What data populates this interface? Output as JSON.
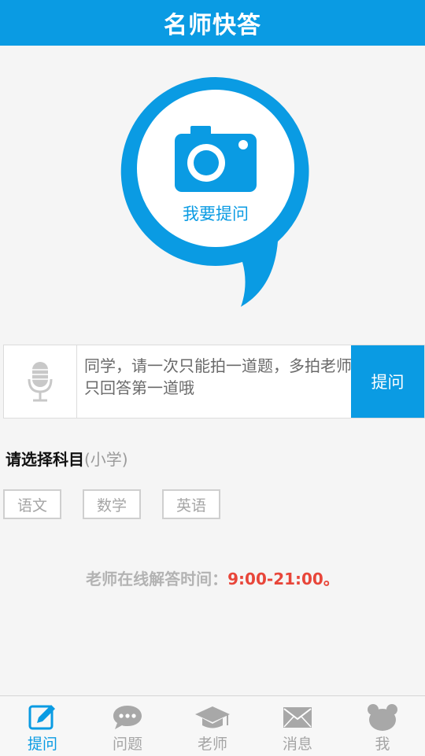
{
  "header": {
    "title": "名师快答"
  },
  "ask": {
    "label": "我要提问"
  },
  "input": {
    "hint": "同学，请一次只能拍一道题，多拍老师只回答第一道哦",
    "submit_label": "提问"
  },
  "subjects": {
    "title": "请选择科目",
    "grade": "(小学)",
    "items": [
      "语文",
      "数学",
      "英语"
    ]
  },
  "hours": {
    "label": "老师在线解答时间：",
    "time": "9:00-21:00。"
  },
  "tabs": [
    {
      "label": "提问",
      "icon": "edit-icon",
      "active": true
    },
    {
      "label": "问题",
      "icon": "chat-bubble-icon"
    },
    {
      "label": "老师",
      "icon": "graduation-cap-icon"
    },
    {
      "label": "消息",
      "icon": "envelope-icon"
    },
    {
      "label": "我",
      "icon": "bear-face-icon"
    }
  ],
  "colors": {
    "primary": "#0a9be3",
    "accent": "#e8463a",
    "muted": "#a5a5a5"
  }
}
